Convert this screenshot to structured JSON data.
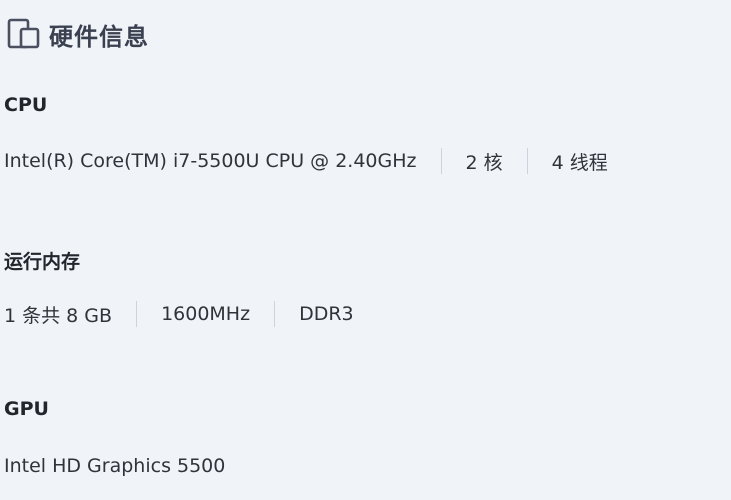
{
  "header": {
    "icon": "devices-icon",
    "title": "硬件信息"
  },
  "cpu": {
    "title": "CPU",
    "model": "Intel(R) Core(TM) i7-5500U CPU @ 2.40GHz",
    "cores": "2 核",
    "threads": "4 线程"
  },
  "memory": {
    "title": "运行内存",
    "summary": "1 条共 8 GB",
    "speed": "1600MHz",
    "type": "DDR3"
  },
  "gpu": {
    "title": "GPU",
    "model": "Intel HD Graphics 5500"
  },
  "colors": {
    "background": "#f0f3f8",
    "separator": "#cdd3dc"
  }
}
